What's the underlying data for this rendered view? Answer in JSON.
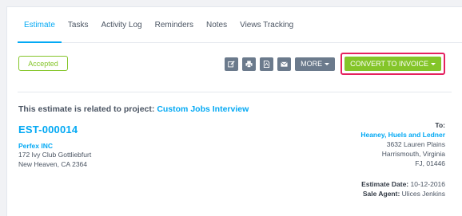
{
  "tabs": [
    {
      "label": "Estimate",
      "active": true
    },
    {
      "label": "Tasks",
      "active": false
    },
    {
      "label": "Activity Log",
      "active": false
    },
    {
      "label": "Reminders",
      "active": false
    },
    {
      "label": "Notes",
      "active": false
    },
    {
      "label": "Views Tracking",
      "active": false
    }
  ],
  "status": "Accepted",
  "toolbar": {
    "icons": [
      "edit-icon",
      "print-icon",
      "pdf-icon",
      "email-icon"
    ],
    "more_label": "MORE",
    "convert_label": "CONVERT TO INVOICE"
  },
  "project": {
    "prefix": "This estimate is related to project:",
    "name": "Custom Jobs Interview"
  },
  "estimate": {
    "number": "EST-000014",
    "from": {
      "company": "Perfex INC",
      "address1": "172 Ivy Club Gottliebfurt",
      "address2": "New Heaven, CA 2364"
    },
    "to": {
      "label": "To:",
      "name": "Heaney, Huels and Ledner",
      "street": "3632 Lauren Plains",
      "city_state": "Harrismouth, Virginia",
      "zip": "FJ, 01446"
    },
    "date_label": "Estimate Date:",
    "date": "10-12-2016",
    "agent_label": "Sale Agent:",
    "agent": "Ulices Jenkins"
  },
  "colors": {
    "accent": "#03a9f4",
    "success": "#84c529",
    "button_gray": "#6b7a8c",
    "highlight": "#e5215f"
  }
}
